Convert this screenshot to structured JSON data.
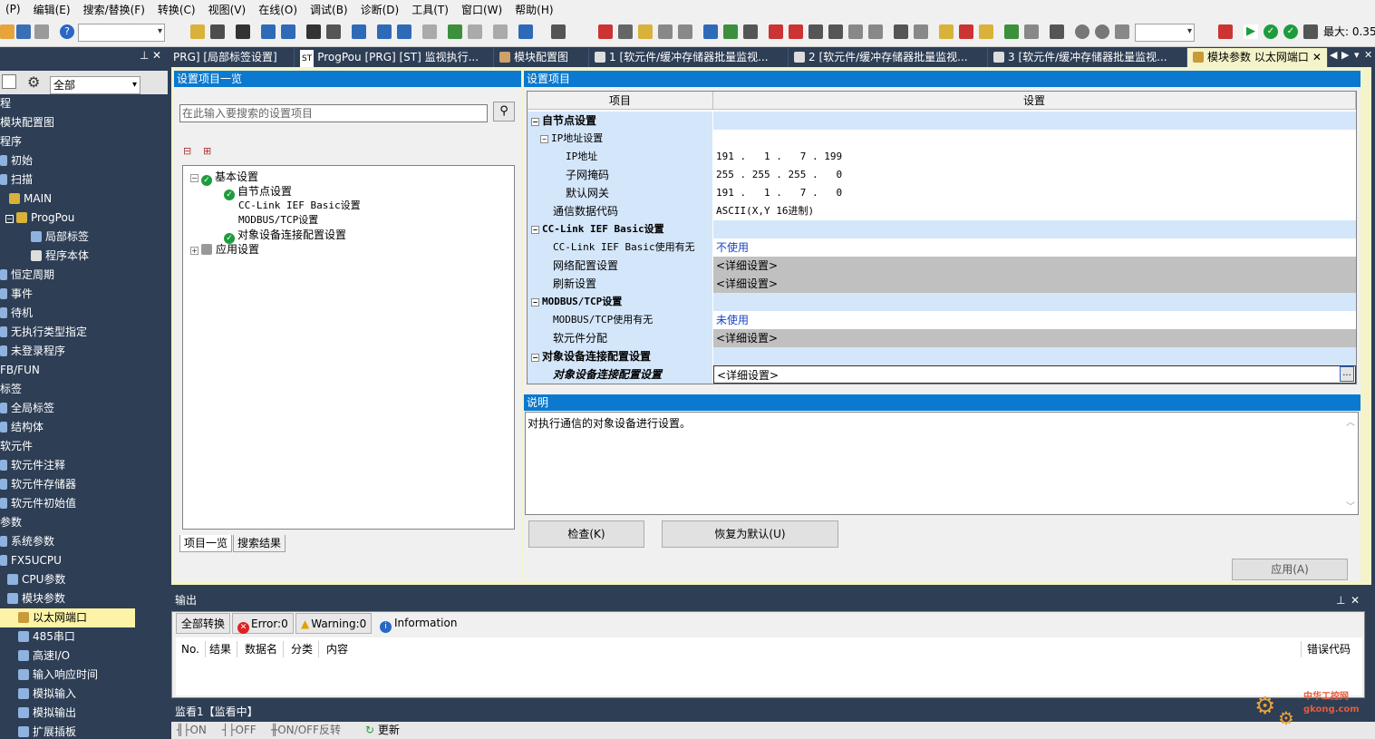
{
  "menu": [
    "(P)",
    "编辑(E)",
    "搜索/替换(F)",
    "转换(C)",
    "视图(V)",
    "在线(O)",
    "调试(B)",
    "诊断(D)",
    "工具(T)",
    "窗口(W)",
    "帮助(H)"
  ],
  "toolbar": {
    "zoom": "最大: 0.35"
  },
  "tabs": [
    {
      "label": "PRG] [局部标签设置]"
    },
    {
      "label": "ProgPou [PRG] [ST] 监视执行..."
    },
    {
      "label": "模块配置图"
    },
    {
      "label": "1 [软元件/缓冲存储器批量监视..."
    },
    {
      "label": "2 [软元件/缓冲存储器批量监视..."
    },
    {
      "label": "3 [软元件/缓冲存储器批量监视..."
    },
    {
      "label": "模块参数 以太网端口"
    }
  ],
  "nav": {
    "filter": "全部",
    "items": [
      "程",
      "模块配置图",
      "程序",
      "初始",
      "扫描",
      "MAIN",
      "ProgPou",
      "局部标签",
      "程序本体",
      "恒定周期",
      "事件",
      "待机",
      "无执行类型指定",
      "未登录程序",
      "FB/FUN",
      "标签",
      "全局标签",
      "结构体",
      "软元件",
      "软元件注释",
      "软元件存储器",
      "软元件初始值",
      "参数",
      "系统参数",
      "FX5UCPU",
      "CPU参数",
      "模块参数",
      "以太网端口",
      "485串口",
      "高速I/O",
      "输入响应时间",
      "模拟输入",
      "模拟输出",
      "扩展插板"
    ]
  },
  "left_panel": {
    "title": "设置项目一览",
    "search_placeholder": "在此输入要搜索的设置项目",
    "tree": [
      "基本设置",
      "自节点设置",
      "CC-Link IEF Basic设置",
      "MODBUS/TCP设置",
      "对象设备连接配置设置",
      "应用设置"
    ],
    "tabs": [
      "项目一览",
      "搜索结果"
    ]
  },
  "settings": {
    "title": "设置项目",
    "col_item": "项目",
    "col_setting": "设置",
    "rows": [
      {
        "item": "自节点设置",
        "value": ""
      },
      {
        "item": "IP地址设置",
        "value": ""
      },
      {
        "item": "IP地址",
        "value": "191 .   1 .   7 . 199"
      },
      {
        "item": "子网掩码",
        "value": "255 . 255 . 255 .   0"
      },
      {
        "item": "默认网关",
        "value": "191 .   1 .   7 .   0"
      },
      {
        "item": "通信数据代码",
        "value": "ASCII(X,Y 16进制)"
      },
      {
        "item": "CC-Link IEF Basic设置",
        "value": ""
      },
      {
        "item": "CC-Link IEF Basic使用有无",
        "value": "不使用"
      },
      {
        "item": "网络配置设置",
        "value": "<详细设置>"
      },
      {
        "item": "刷新设置",
        "value": "<详细设置>"
      },
      {
        "item": "MODBUS/TCP设置",
        "value": ""
      },
      {
        "item": "MODBUS/TCP使用有无",
        "value": "未使用"
      },
      {
        "item": "软元件分配",
        "value": "<详细设置>"
      },
      {
        "item": "对象设备连接配置设置",
        "value": ""
      },
      {
        "item": "对象设备连接配置设置",
        "value": "<详细设置>"
      }
    ],
    "browse": "..."
  },
  "explain": {
    "title": "说明",
    "text": "对执行通信的对象设备进行设置。"
  },
  "buttons": {
    "check": "检查(K)",
    "reset": "恢复为默认(U)",
    "apply": "应用(A)"
  },
  "output": {
    "title": "输出",
    "tabs": [
      "全部转换",
      "Error:0",
      "Warning:0",
      "Information"
    ],
    "cols": [
      "No.",
      "结果",
      "数据名",
      "分类",
      "内容",
      "错误代码"
    ]
  },
  "watch": {
    "title": "监看1【监看中】",
    "buttons": [
      "ON",
      "OFF",
      "ON/OFF反转",
      "更新"
    ]
  },
  "watermark": "中华工控网 gkong.com",
  "colors": {
    "accent": "#0a79cf",
    "nav_bg": "#2d3e55",
    "selected": "#fcf3a6",
    "active_tab": "#f5f3c9"
  }
}
